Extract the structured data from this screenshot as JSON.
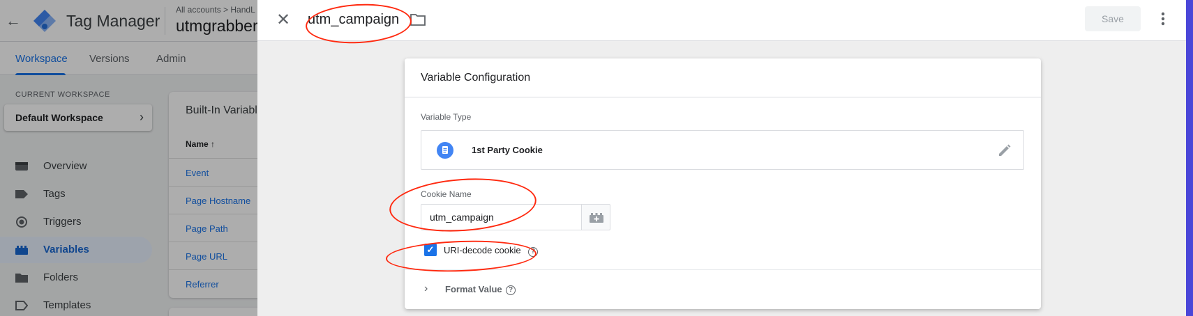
{
  "background_app": {
    "app_title": "Tag Manager",
    "breadcrumb": "All accounts > HandL",
    "container_name": "utmgrabber",
    "tabs": [
      {
        "label": "Workspace",
        "active": true
      },
      {
        "label": "Versions",
        "active": false
      },
      {
        "label": "Admin",
        "active": false
      }
    ],
    "current_workspace_label": "CURRENT WORKSPACE",
    "workspace_name": "Default Workspace",
    "nav_items": [
      {
        "label": "Overview",
        "icon": "overview-icon",
        "active": false
      },
      {
        "label": "Tags",
        "icon": "tag-icon",
        "active": false
      },
      {
        "label": "Triggers",
        "icon": "trigger-icon",
        "active": false
      },
      {
        "label": "Variables",
        "icon": "variables-icon",
        "active": true
      },
      {
        "label": "Folders",
        "icon": "folder-icon",
        "active": false
      },
      {
        "label": "Templates",
        "icon": "templates-icon",
        "active": false
      }
    ],
    "builtin_title": "Built-In Variabl",
    "builtin_column": "Name ↑",
    "builtin_rows": [
      "Event",
      "Page Hostname",
      "Page Path",
      "Page URL",
      "Referrer"
    ]
  },
  "panel": {
    "variable_name": "utm_campaign",
    "save_label": "Save",
    "card_title": "Variable Configuration",
    "variable_type_label": "Variable Type",
    "variable_type": "1st Party Cookie",
    "cookie_name_label": "Cookie Name",
    "cookie_name_value": "utm_campaign",
    "uri_decode_label": "URI-decode cookie",
    "uri_decode_checked": true,
    "format_value_label": "Format Value"
  },
  "colors": {
    "accent": "#1a73e8",
    "annotation": "#ff2a10",
    "frame": "#4a46d8"
  }
}
